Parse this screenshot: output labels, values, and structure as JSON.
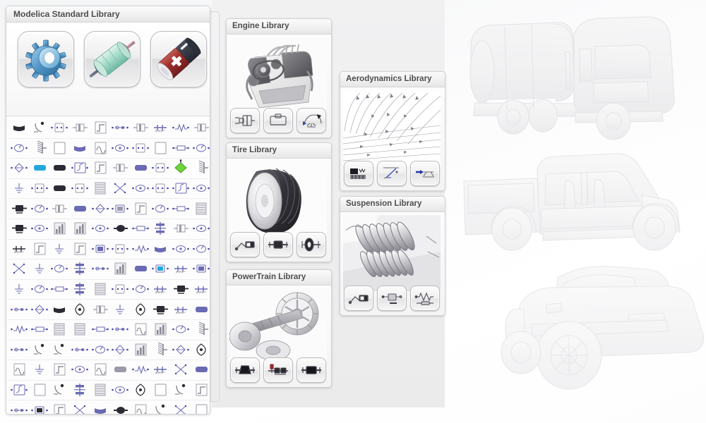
{
  "window": {
    "background_color": "#fbfbfc"
  },
  "msl_panel": {
    "title": "Modelica Standard Library",
    "tiles": [
      {
        "name": "mechanics-gear-tile",
        "label": "Mechanics",
        "color": "#5b9ac8"
      },
      {
        "name": "thermal-capacitor-tile",
        "label": "Thermal",
        "color": "#9fd3c2"
      },
      {
        "name": "electrical-battery-tile",
        "label": "Electrical",
        "color": "#a03a3a"
      }
    ],
    "grid": {
      "columns": 10,
      "rows": 15,
      "highlight": {
        "name": "selected-component-icon",
        "column": 8,
        "row": 2,
        "color": "#6ed43e"
      },
      "icon_colors": {
        "default_stroke": "#6a6ab4",
        "node_dot": "#4b3fa8",
        "outline": "#9a9aa8",
        "dark": "#2b2b33",
        "blue_fill": "#1f8fe0",
        "orange_fill": "#e8873c",
        "green_fill": "#6ed43e",
        "yellowgreen_fill": "#c3d95a",
        "cyan_fill": "#25a6d8",
        "red_fill": "#c1332b"
      }
    }
  },
  "libraries": [
    {
      "id": "engine",
      "title": "Engine Library",
      "artwork": "v-engine-block-render",
      "icons": [
        {
          "name": "engine-cylinder-icon"
        },
        {
          "name": "engine-block-icon"
        },
        {
          "name": "engine-throttle-icon"
        }
      ]
    },
    {
      "id": "tire",
      "title": "Tire Library",
      "artwork": "tire-wheel-render",
      "icons": [
        {
          "name": "tire-force-element-icon"
        },
        {
          "name": "tire-axle-icon"
        },
        {
          "name": "tire-wheel-assembly-icon"
        }
      ]
    },
    {
      "id": "powertrain",
      "title": "PowerTrain Library",
      "artwork": "gear-shaft-render",
      "icons": [
        {
          "name": "powertrain-clutch-icon"
        },
        {
          "name": "powertrain-gearbox-icon"
        },
        {
          "name": "powertrain-rotor-icon"
        }
      ]
    },
    {
      "id": "aerodynamics",
      "title": "Aerodynamics Library",
      "artwork": "streamline-flow-field-render",
      "icons": [
        {
          "name": "aero-flowmap-icon"
        },
        {
          "name": "aero-lift-curve-icon"
        },
        {
          "name": "aero-drag-body-icon"
        }
      ]
    },
    {
      "id": "suspension",
      "title": "Suspension Library",
      "artwork": "coil-spring-render",
      "icons": [
        {
          "name": "suspension-damper-icon"
        },
        {
          "name": "suspension-mass-icon"
        },
        {
          "name": "suspension-spring-icon"
        }
      ]
    }
  ],
  "ghost_vehicles": [
    {
      "name": "tanker-truck-ghost",
      "position": "top-right"
    },
    {
      "name": "pickup-truck-ghost",
      "position": "middle-right"
    },
    {
      "name": "sports-car-ghost",
      "position": "bottom-right"
    }
  ]
}
